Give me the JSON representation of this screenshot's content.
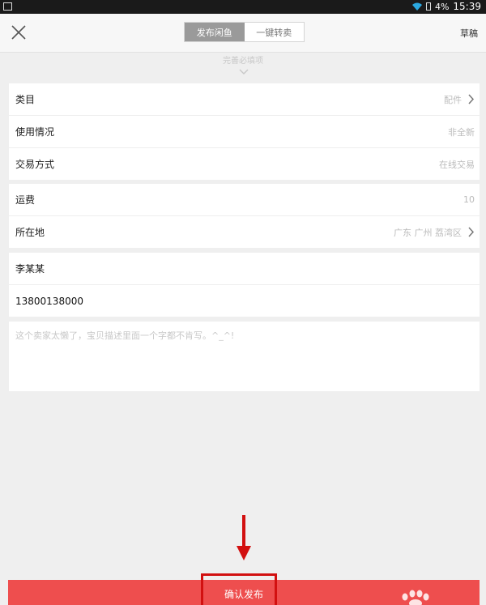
{
  "status_bar": {
    "battery": "4%",
    "time": "15:39"
  },
  "header": {
    "tabs": [
      {
        "label": "发布闲鱼",
        "active": true
      },
      {
        "label": "一键转卖",
        "active": false
      }
    ],
    "draft_label": "草稿"
  },
  "hint": "完善必填项",
  "details": [
    {
      "label": "类目",
      "value": "配件",
      "has_arrow": true
    },
    {
      "label": "使用情况",
      "value": "非全新",
      "has_arrow": false
    },
    {
      "label": "交易方式",
      "value": "在线交易",
      "has_arrow": false
    }
  ],
  "shipping": [
    {
      "label": "运费",
      "value": "10",
      "has_arrow": false
    },
    {
      "label": "所在地",
      "value": "广东 广州 荔湾区",
      "has_arrow": true
    }
  ],
  "contact": {
    "name": "李某某",
    "phone": "13800138000"
  },
  "description_placeholder": "这个卖家太懒了，宝贝描述里面一个字都不肯写。^_^!",
  "confirm_label": "确认发布",
  "colors": {
    "accent_red": "#ee4e4e",
    "highlight": "#d21010",
    "tab_active": "#9a9a9a"
  }
}
